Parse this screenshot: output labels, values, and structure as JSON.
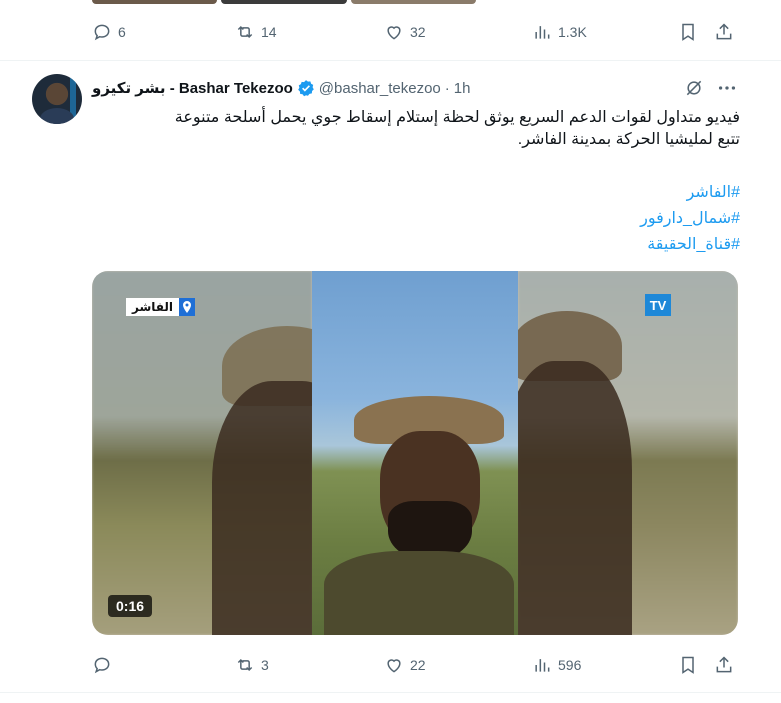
{
  "prev_tweet": {
    "replies": "6",
    "retweets": "14",
    "likes": "32",
    "views": "1.3K"
  },
  "tweet": {
    "author_name": "بشر تكيزو - Bashar Tekezoo",
    "handle": "@bashar_tekezoo",
    "dot": "·",
    "time": "1h",
    "body_line1": "فيديو متداول لقوات الدعم السريع يوثق لحظة إستلام إسقاط جوي يحمل أسلحة متنوعة",
    "body_line2": "تتبع لمليشيا الحركة بمدينة الفاشر.",
    "hashtags": [
      "#الفاشر",
      "#شمال_دارفور",
      "#قناة_الحقيقة"
    ],
    "media": {
      "location_label": "الفاشر",
      "channel_logo": "TV",
      "duration": "0:16"
    },
    "replies": "",
    "retweets": "3",
    "likes": "22",
    "views": "596"
  },
  "colors": {
    "accent": "#1d9bf0",
    "muted": "#536471",
    "text": "#0f1419"
  },
  "icons": [
    "reply-icon",
    "retweet-icon",
    "like-icon",
    "views-icon",
    "bookmark-icon",
    "share-icon",
    "verified-badge-icon",
    "grok-icon",
    "more-icon",
    "location-pin-icon"
  ]
}
